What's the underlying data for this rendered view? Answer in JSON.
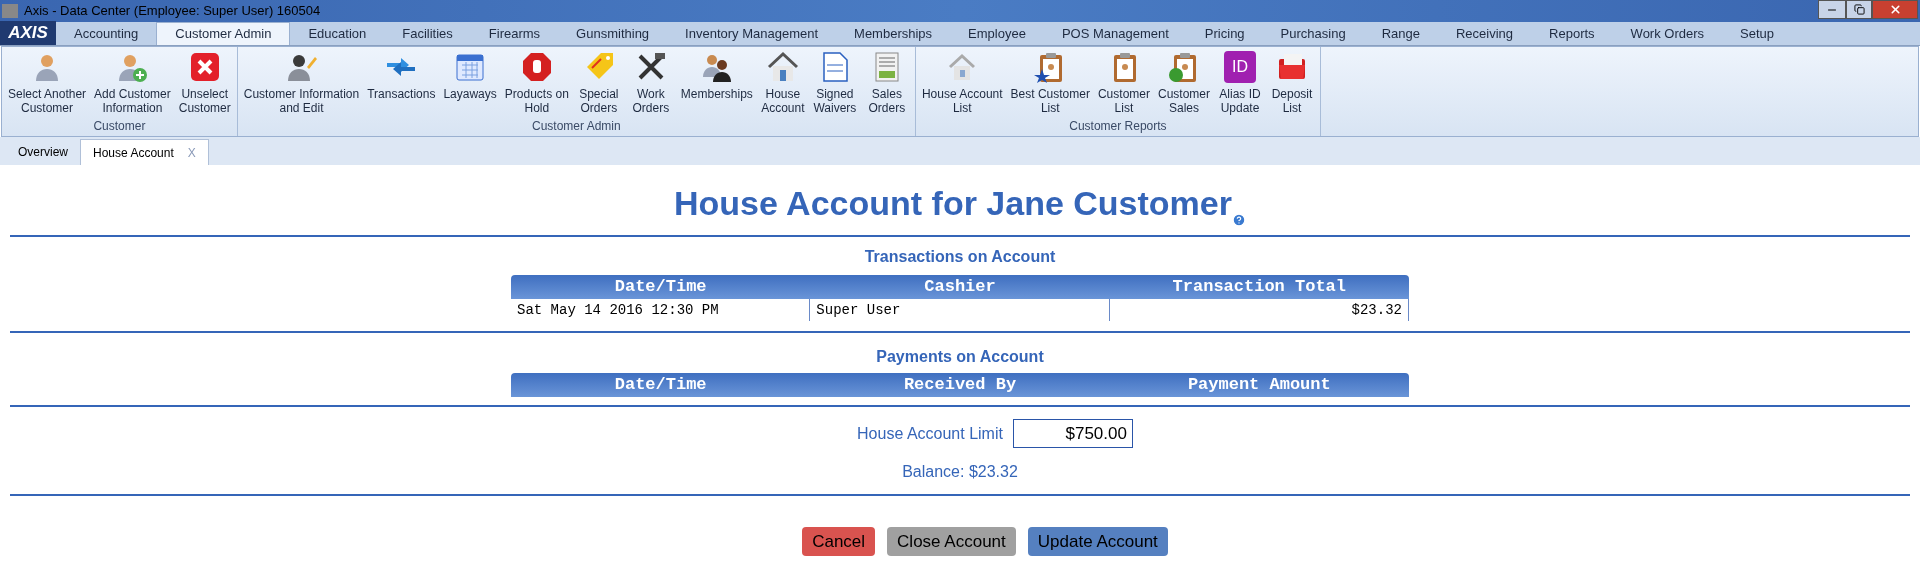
{
  "window": {
    "title": "Axis - Data Center  (Employee: Super User) 160504",
    "logo": "AXIS"
  },
  "menu_tabs": [
    {
      "label": "Accounting",
      "selected": false
    },
    {
      "label": "Customer Admin",
      "selected": true
    },
    {
      "label": "Education",
      "selected": false
    },
    {
      "label": "Facilities",
      "selected": false
    },
    {
      "label": "Firearms",
      "selected": false
    },
    {
      "label": "Gunsmithing",
      "selected": false
    },
    {
      "label": "Inventory Management",
      "selected": false
    },
    {
      "label": "Memberships",
      "selected": false
    },
    {
      "label": "Employee",
      "selected": false
    },
    {
      "label": "POS Management",
      "selected": false
    },
    {
      "label": "Pricing",
      "selected": false
    },
    {
      "label": "Purchasing",
      "selected": false
    },
    {
      "label": "Range",
      "selected": false
    },
    {
      "label": "Receiving",
      "selected": false
    },
    {
      "label": "Reports",
      "selected": false
    },
    {
      "label": "Work Orders",
      "selected": false
    },
    {
      "label": "Setup",
      "selected": false
    }
  ],
  "ribbon_groups": [
    {
      "title": "Customer",
      "items": [
        {
          "label": "Select Another\nCustomer",
          "kind": "user"
        },
        {
          "label": "Add Customer\nInformation",
          "kind": "user-add"
        },
        {
          "label": "Unselect\nCustomer",
          "kind": "x"
        }
      ]
    },
    {
      "title": "Customer Admin",
      "items": [
        {
          "label": "Customer Information\nand Edit",
          "kind": "user-edit"
        },
        {
          "label": "Transactions",
          "kind": "arrows"
        },
        {
          "label": "Layaways",
          "kind": "calendar"
        },
        {
          "label": "Products on\nHold",
          "kind": "stop"
        },
        {
          "label": "Special\nOrders",
          "kind": "tag"
        },
        {
          "label": "Work\nOrders",
          "kind": "tools"
        },
        {
          "label": "Memberships",
          "kind": "users"
        },
        {
          "label": "House\nAccount",
          "kind": "house"
        },
        {
          "label": "Signed\nWaivers",
          "kind": "document"
        },
        {
          "label": "Sales\nOrders",
          "kind": "receipt"
        }
      ]
    },
    {
      "title": "Customer Reports",
      "items": [
        {
          "label": "House Account\nList",
          "kind": "house-faded"
        },
        {
          "label": "Best Customer\nList",
          "kind": "clipboard-star"
        },
        {
          "label": "Customer\nList",
          "kind": "clipboard"
        },
        {
          "label": "Customer\nSales",
          "kind": "clipboard-dollar"
        },
        {
          "label": "Alias ID\nUpdate",
          "kind": "id",
          "icon_text": "ID"
        },
        {
          "label": "Deposit\nList",
          "kind": "folder"
        }
      ]
    }
  ],
  "doc_tabs": [
    {
      "label": "Overview",
      "selected": false
    },
    {
      "label": "House Account",
      "selected": true,
      "close_label": "X"
    }
  ],
  "page": {
    "title": "House Account for Jane Customer",
    "transactions": {
      "title": "Transactions on Account",
      "columns": [
        "Date/Time",
        "Cashier",
        "Transaction Total"
      ],
      "rows": [
        [
          "Sat May 14 2016 12:30 PM",
          "Super User",
          "$23.32"
        ]
      ]
    },
    "payments": {
      "title": "Payments on Account",
      "columns": [
        "Date/Time",
        "Received By",
        "Payment Amount"
      ]
    },
    "limit": {
      "label": "House Account Limit",
      "value": "$750.00"
    },
    "balance": "Balance: $23.32",
    "buttons": [
      {
        "label": "Cancel",
        "kind": "danger"
      },
      {
        "label": "Close Account",
        "kind": "neutral"
      },
      {
        "label": "Update Account",
        "kind": "primary"
      }
    ]
  }
}
